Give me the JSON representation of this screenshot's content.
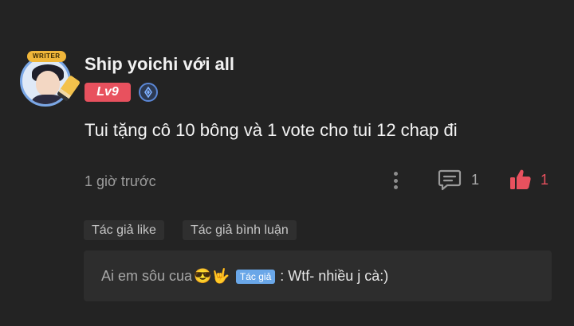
{
  "user": {
    "name": "Ship yoichi với all",
    "avatar_badge": "WRITER",
    "level": "Lv9"
  },
  "comment": {
    "text": "Tui tặng cô 10 bông và 1 vote cho tui 12 chap đi",
    "time": "1 giờ trước"
  },
  "actions": {
    "reply_count": "1",
    "like_count": "1"
  },
  "chips": [
    "Tác giả like",
    "Tác giả bình luận"
  ],
  "author_reply": {
    "name": "Ai em sôu cua",
    "emoji": "😎🤟",
    "tag": "Tác giả",
    "text": ": Wtf- nhiều j cà:)"
  },
  "colors": {
    "background": "#232323",
    "level_badge": "#e8515e",
    "like": "#e8515e",
    "author_tag": "#6aa7e8"
  },
  "icons": [
    "more-vertical-icon",
    "comment-icon",
    "thumbs-up-icon",
    "verified-badge-icon"
  ]
}
